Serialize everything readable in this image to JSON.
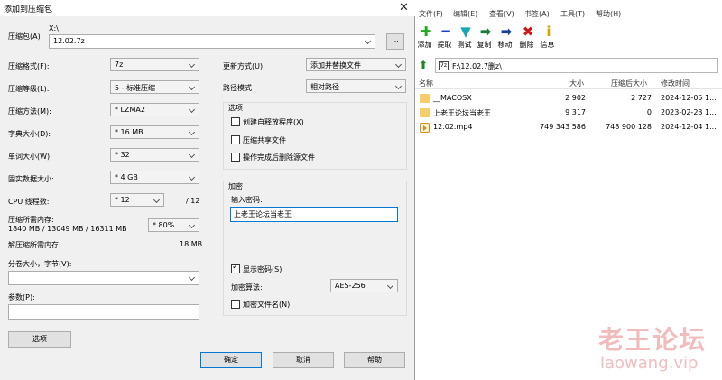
{
  "dialog": {
    "title": "添加到压缩包",
    "close": "✕",
    "archive_label": "压缩包(A)",
    "archive_path": "X:\\",
    "archive_name": "12.02.7z",
    "browse_button": "...",
    "left_fields": [
      {
        "label": "压缩格式(F):",
        "value": "7z"
      },
      {
        "label": "压缩等级(L):",
        "value": "5 - 标准压缩"
      },
      {
        "label": "压缩方法(M):",
        "value": "* LZMA2"
      },
      {
        "label": "字典大小(D):",
        "value": "* 16 MB"
      },
      {
        "label": "单词大小(W):",
        "value": "* 32"
      },
      {
        "label": "固实数据大小:",
        "value": "* 4 GB"
      }
    ],
    "cpu_label": "CPU 线程数:",
    "cpu_value": "* 12",
    "cpu_max": "/ 12",
    "mem_label": "压缩所需内存:",
    "mem_detail": "1840 MB / 13049 MB / 16311 MB",
    "mem_percent": "* 80%",
    "decomp_label": "解压缩所需内存:",
    "decomp_value": "18 MB",
    "volume_label": "分卷大小，字节(V):",
    "params_label": "参数(P):",
    "options_button": "选项",
    "update_label": "更新方式(U):",
    "update_value": "添加并替换文件",
    "path_label": "路径模式",
    "path_value": "相对路径",
    "options_group": "选项",
    "option_checks": [
      {
        "label": "创建自释放程序(X)",
        "checked": false
      },
      {
        "label": "压缩共享文件",
        "checked": false
      },
      {
        "label": "操作完成后删除源文件",
        "checked": false
      }
    ],
    "encrypt_group": "加密",
    "password_label": "输入密码:",
    "password_value": "上老王论坛当老王",
    "show_password": "显示密码(S)",
    "encrypt_method_label": "加密算法:",
    "encrypt_method_value": "AES-256",
    "encrypt_names": "加密文件名(N)",
    "ok": "确定",
    "cancel": "取消",
    "help": "帮助"
  },
  "fm": {
    "menu": [
      "文件(F)",
      "编辑(E)",
      "查看(V)",
      "书签(A)",
      "工具(T)",
      "帮助(H)"
    ],
    "toolbar": [
      {
        "icon": "add-icon",
        "glyph": "✚",
        "color": "#1fa81f",
        "label": "添加"
      },
      {
        "icon": "extract-icon",
        "glyph": "━",
        "color": "#1a3fd0",
        "label": "提取"
      },
      {
        "icon": "test-icon",
        "glyph": "▼",
        "color": "#1aa8b0",
        "label": "测试"
      },
      {
        "icon": "copy-icon",
        "glyph": "➡",
        "color": "#1a7a3a",
        "label": "复制"
      },
      {
        "icon": "move-icon",
        "glyph": "➡",
        "color": "#1a3fa0",
        "label": "移动"
      },
      {
        "icon": "delete-icon",
        "glyph": "✖",
        "color": "#d01a1a",
        "label": "删除"
      },
      {
        "icon": "info-icon",
        "glyph": "i",
        "color": "#d6a400",
        "label": "信息"
      }
    ],
    "address": "F:\\12.02.7删z\\",
    "columns": [
      "名称",
      "大小",
      "压缩后大小",
      "修改时间"
    ],
    "rows": [
      {
        "name": "__MACOSX",
        "size": "2 902",
        "packed": "2 727",
        "modified": "2024-12-05 1...",
        "type": "folder"
      },
      {
        "name": "上老王论坛当老王",
        "size": "9 317",
        "packed": "0",
        "modified": "2023-02-23 1...",
        "type": "folder"
      },
      {
        "name": "12.02.mp4",
        "size": "749 343 586",
        "packed": "748 900 128",
        "modified": "2024-12-04 1...",
        "type": "file"
      }
    ]
  },
  "watermark": {
    "cn": "老王论坛",
    "en": "laowang.vip"
  }
}
